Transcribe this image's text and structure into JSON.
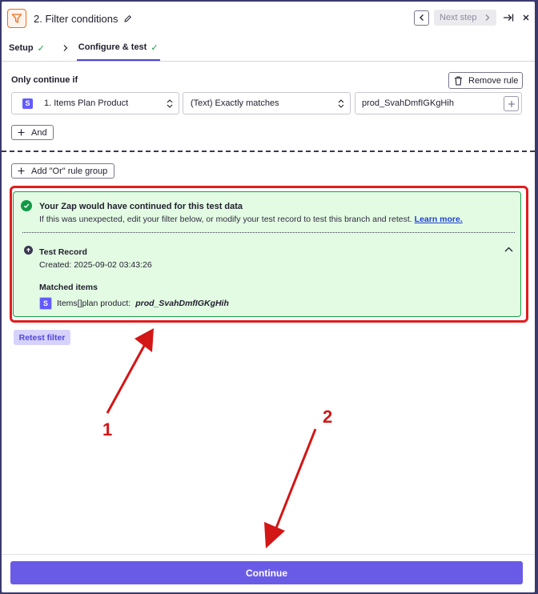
{
  "header": {
    "title": "2. Filter conditions",
    "next_step_label": "Next step"
  },
  "tabs": [
    {
      "label": "Setup"
    },
    {
      "label": "Configure & test"
    }
  ],
  "rule": {
    "section_label": "Only continue if",
    "remove_label": "Remove rule",
    "field": "1. Items Plan Product",
    "operator": "(Text) Exactly matches",
    "value": "prod_SvahDmfIGKgHih",
    "and_label": "And",
    "or_label": "Add \"Or\" rule group"
  },
  "result": {
    "title": "Your Zap would have continued for this test data",
    "description": "If this was unexpected, edit your filter below, or modify your test record to test this branch and retest.",
    "learn_more": "Learn more.",
    "record_title": "Test Record",
    "created": "Created: 2025-09-02 03:43:26",
    "matched_label": "Matched items",
    "matched_key": "Items[]plan product:",
    "matched_value": "prod_SvahDmfIGKgHih"
  },
  "retest_label": "Retest filter",
  "annotations": {
    "one": "1",
    "two": "2"
  },
  "continue_label": "Continue",
  "colors": {
    "accent": "#6a5be6",
    "success_bg": "#e3fbe3",
    "success": "#17a045",
    "highlight": "#e11d1d",
    "step_icon": "#f26b1d"
  },
  "icons": [
    "filter-icon",
    "pencil-icon",
    "chevron-left-icon",
    "chevron-right-icon",
    "skip-to-end-icon",
    "close-icon",
    "trash-icon",
    "plus-icon",
    "sort-icon",
    "check-circle-icon",
    "upload-icon",
    "chevron-up-icon"
  ]
}
